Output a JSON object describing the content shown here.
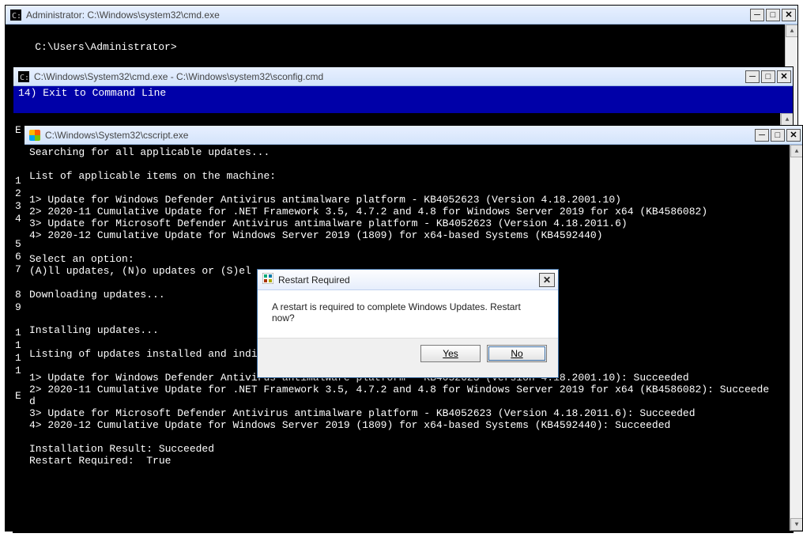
{
  "win1": {
    "title": "Administrator: C:\\Windows\\system32\\cmd.exe",
    "prompt": "C:\\Users\\Administrator>"
  },
  "win2": {
    "title": "C:\\Windows\\System32\\cmd.exe - C:\\Windows\\system32\\sconfig.cmd",
    "menu14": "14) Exit to Command Line",
    "nums_a": "E\n\n\n\n1\n2\n3\n4\n\n5\n6\n7\n\n8\n9\n\n1\n1\n1\n1\n\nE"
  },
  "win3": {
    "title": "C:\\Windows\\System32\\cscript.exe",
    "lines": [
      "Searching for all applicable updates...",
      "",
      "List of applicable items on the machine:",
      "",
      "1> Update for Windows Defender Antivirus antimalware platform - KB4052623 (Version 4.18.2001.10)",
      "2> 2020-11 Cumulative Update for .NET Framework 3.5, 4.7.2 and 4.8 for Windows Server 2019 for x64 (KB4586082)",
      "3> Update for Microsoft Defender Antivirus antimalware platform - KB4052623 (Version 4.18.2011.6)",
      "4> 2020-12 Cumulative Update for Windows Server 2019 (1809) for x64-based Systems (KB4592440)",
      "",
      "Select an option:",
      "(A)ll updates, (N)o updates or (S)el",
      "",
      "Downloading updates...",
      "",
      "",
      "Installing updates...",
      "",
      "Listing of updates installed and individual installation results:",
      "",
      "1> Update for Windows Defender Antivirus antimalware platform - KB4052623 (Version 4.18.2001.10): Succeeded",
      "2> 2020-11 Cumulative Update for .NET Framework 3.5, 4.7.2 and 4.8 for Windows Server 2019 for x64 (KB4586082): Succeede",
      "d",
      "3> Update for Microsoft Defender Antivirus antimalware platform - KB4052623 (Version 4.18.2011.6): Succeeded",
      "4> 2020-12 Cumulative Update for Windows Server 2019 (1809) for x64-based Systems (KB4592440): Succeeded",
      "",
      "Installation Result: Succeeded",
      "Restart Required:  True"
    ]
  },
  "dialog": {
    "title": "Restart Required",
    "message": "A restart is required to complete Windows Updates. Restart now?",
    "yes": "Yes",
    "no": "No"
  },
  "glyph": {
    "min": "─",
    "max": "□",
    "close": "✕",
    "x": "✕"
  }
}
